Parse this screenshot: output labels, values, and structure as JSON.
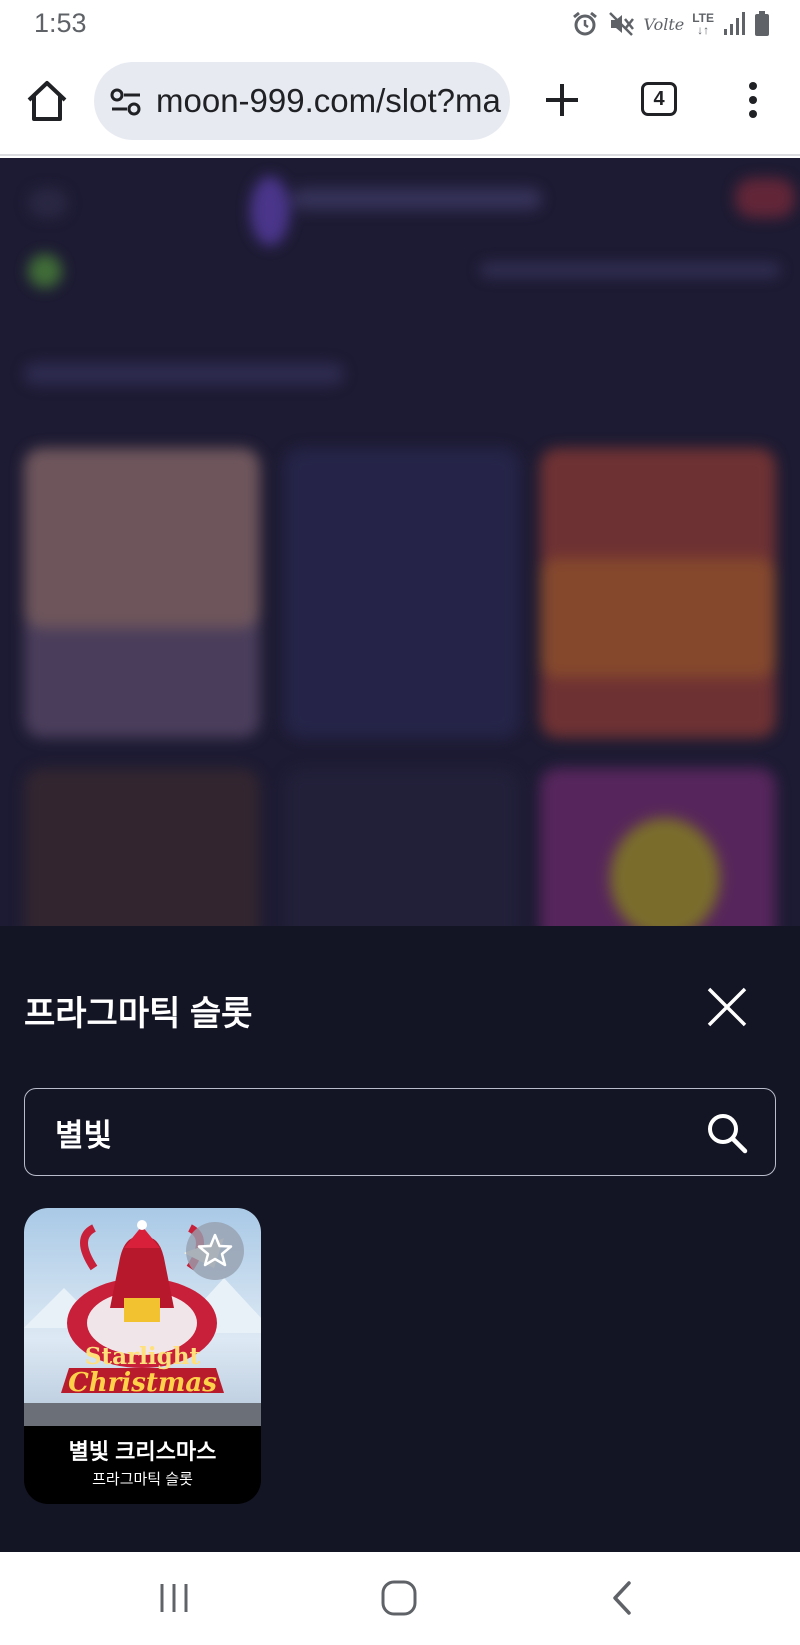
{
  "status_bar": {
    "time": "1:53",
    "volte": "Volte",
    "lte": "LTE",
    "icons": [
      "alarm-icon",
      "vibrate-off-icon",
      "volte-icon",
      "lte-icon",
      "signal-icon",
      "battery-icon"
    ]
  },
  "browser": {
    "url": "moon-999.com/slot?ma",
    "tab_count": "4",
    "icons": [
      "home-icon",
      "site-settings-icon",
      "new-tab-icon",
      "tabs-icon",
      "menu-icon"
    ]
  },
  "sheet": {
    "title": "프라그마틱 슬롯",
    "search_value": "별빛",
    "results": [
      {
        "name": "별빛 크리스마스",
        "provider": "프라그마틱 슬롯",
        "logo_line1": "Starlight",
        "logo_line2": "Christmas"
      }
    ]
  },
  "nav": {
    "icons": [
      "recent-apps-icon",
      "home-icon",
      "back-icon"
    ]
  },
  "colors": {
    "sheet_bg": "#131424",
    "page_dim_bg": "#1d1b33",
    "url_box_bg": "#e8eaf2"
  }
}
